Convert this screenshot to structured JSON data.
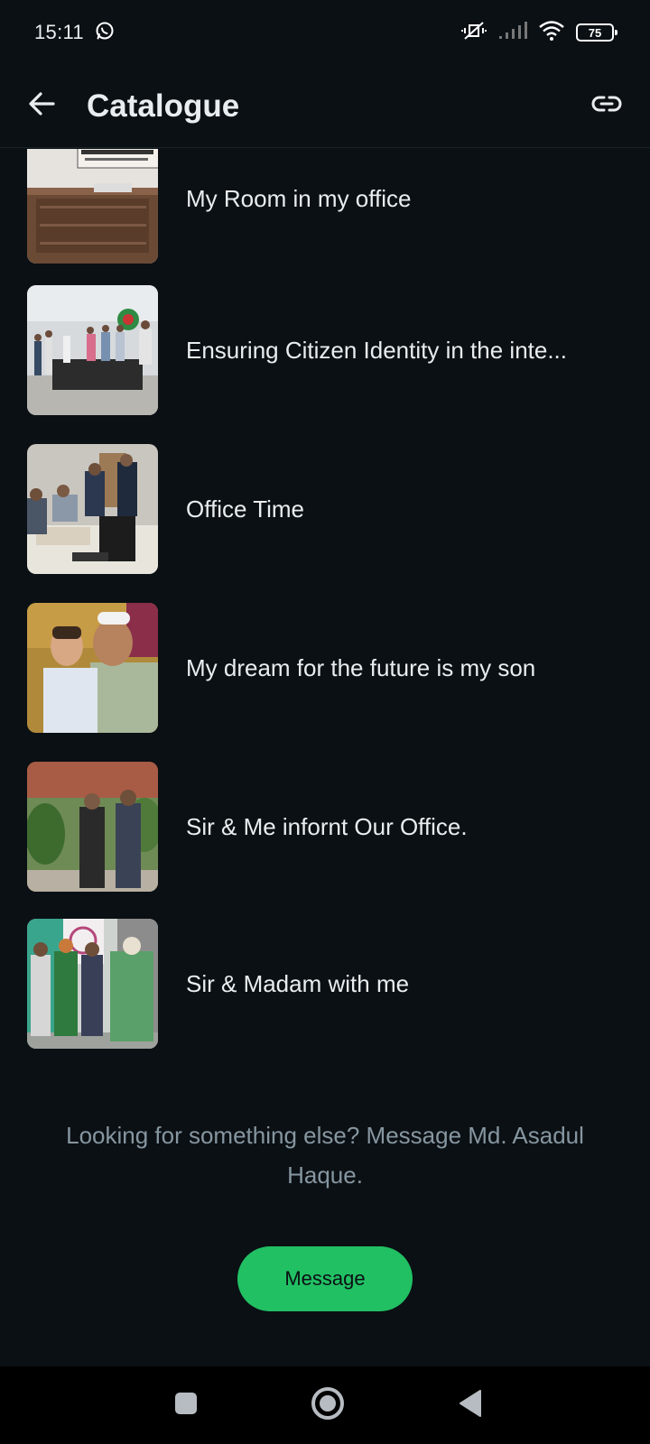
{
  "status_bar": {
    "time": "15:11",
    "battery": "75",
    "icons": [
      "whatsapp-icon",
      "mute-vibrate-icon",
      "signal-icon",
      "wifi-icon",
      "battery-icon"
    ]
  },
  "app_bar": {
    "title": "Catalogue",
    "back_icon": "arrow-back-icon",
    "link_icon": "link-icon"
  },
  "items": [
    {
      "title": "My Room in my office"
    },
    {
      "title": "Ensuring Citizen Identity in the inte..."
    },
    {
      "title": "Office Time"
    },
    {
      "title": "My dream for the future is my son"
    },
    {
      "title": "Sir & Me infornt Our Office."
    },
    {
      "title": "Sir & Madam with me"
    }
  ],
  "footer": {
    "text": "Looking for something else? Message Md. Asadul Haque.",
    "button_label": "Message"
  },
  "colors": {
    "background": "#0b1014",
    "accent": "#21c063",
    "text_primary": "#e9edef",
    "text_secondary": "#8696a0"
  },
  "nav_bar": {
    "icons": [
      "recent-apps-icon",
      "home-icon",
      "back-triangle-icon"
    ]
  }
}
